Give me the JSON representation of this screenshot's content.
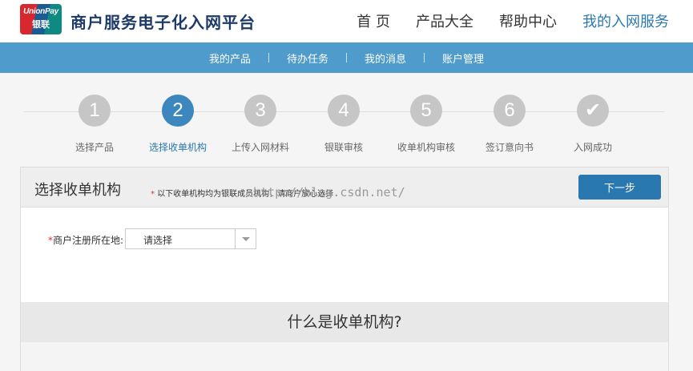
{
  "header": {
    "logo_text_en": "UnionPay",
    "logo_text_cn": "银联",
    "site_title": "商户服务电子化入网平台",
    "nav": [
      "首 页",
      "产品大全",
      "帮助中心",
      "我的入网服务"
    ],
    "active_nav": 3
  },
  "subnav": [
    "我的产品",
    "待办任务",
    "我的消息",
    "账户管理"
  ],
  "steps": [
    {
      "num": "1",
      "label": "选择产品",
      "done": false
    },
    {
      "num": "2",
      "label": "选择收单机构",
      "done": false
    },
    {
      "num": "3",
      "label": "上传入网材料",
      "done": false
    },
    {
      "num": "4",
      "label": "银联审核",
      "done": false
    },
    {
      "num": "5",
      "label": "收单机构审核",
      "done": false
    },
    {
      "num": "6",
      "label": "签订意向书",
      "done": false
    },
    {
      "num": "✔",
      "label": "入网成功",
      "done": true
    }
  ],
  "active_step": 1,
  "panel": {
    "title": "选择收单机构",
    "note": "以下收单机构均为银联成员机构，请商户放心选择",
    "watermark": "http://blog.csdn.net/",
    "next_label": "下一步",
    "field_label": "商户注册所在地:",
    "select_value": "请选择",
    "faq_title": "什么是收单机构?"
  },
  "colors": {
    "accent": "#2a78b0",
    "subnav_bg": "#4f9bcb",
    "inactive_step": "#c6c6c6"
  }
}
